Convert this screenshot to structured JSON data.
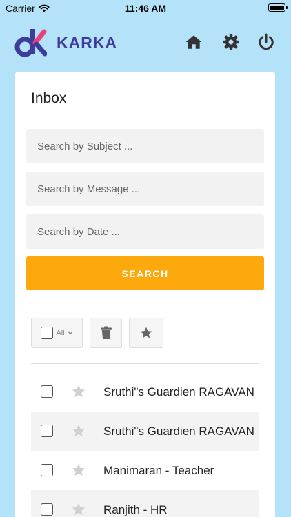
{
  "status_bar": {
    "carrier": "Carrier",
    "time": "11:46 AM"
  },
  "header": {
    "app_name": "KARKA",
    "icons": [
      "home-icon",
      "gear-icon",
      "power-icon"
    ]
  },
  "inbox": {
    "title": "Inbox",
    "subject_placeholder": "Search by Subject ...",
    "message_placeholder": "Search by Message ...",
    "date_placeholder": "Search by Date ...",
    "search_label": "SEARCH",
    "select_all_label": "All"
  },
  "messages": [
    {
      "sender": "Sruthi\"s Guardien RAGAVAN"
    },
    {
      "sender": "Sruthi\"s Guardien RAGAVAN"
    },
    {
      "sender": "Manimaran - Teacher"
    },
    {
      "sender": "Ranjith - HR"
    }
  ],
  "colors": {
    "background": "#b3e2f9",
    "accent": "#fda90d",
    "brand_blue": "#3d3c9c",
    "brand_pink": "#e8417e"
  }
}
